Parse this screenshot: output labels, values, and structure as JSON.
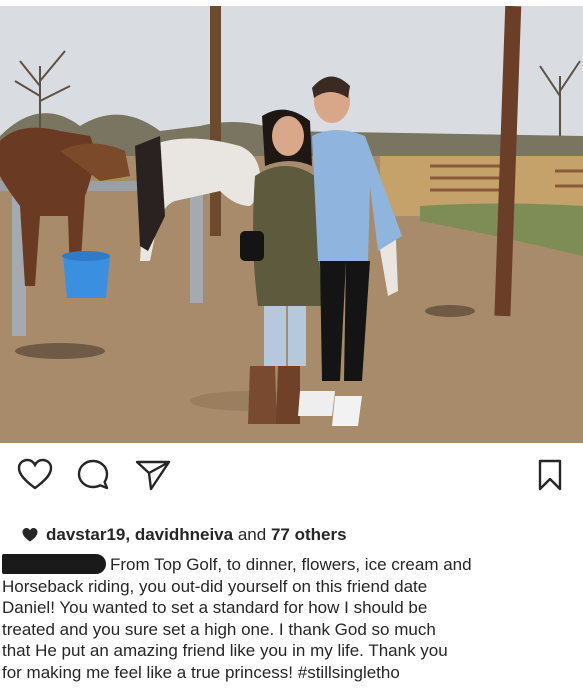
{
  "post": {
    "likes": {
      "usernames": "davstar19, davidhneiva",
      "connector": "and",
      "others": "77 others"
    },
    "caption": {
      "author_redacted": true,
      "lines": [
        "From Top Golf, to dinner, flowers, ice cream and",
        "Horseback riding, you out-did yourself on this friend date",
        "Daniel! You wanted to set a standard for how I should be",
        "treated and you sure set a high one. I thank God so much",
        "that He put an amazing friend like you in my life. Thank you",
        "for making me feel like a true princess!"
      ],
      "hashtag": "#stillsingletho"
    }
  },
  "icons": {
    "like": "heart-outline-icon",
    "comment": "comment-bubble-icon",
    "share": "paper-plane-icon",
    "save": "bookmark-icon",
    "likes_marker": "heart-filled-icon"
  },
  "colors": {
    "text": "#262626",
    "redaction": "#1a1a1a"
  }
}
